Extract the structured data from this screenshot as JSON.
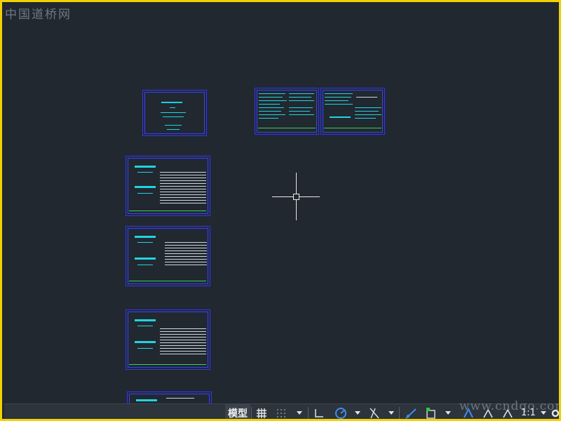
{
  "watermark_top": "中国道桥网",
  "watermark_bottom": "www.cndqo.com",
  "statusbar": {
    "model_label": "模型",
    "scale_label": "1:1",
    "icons": [
      "grid-icon",
      "snap-icon",
      "ortho-icon",
      "polar-icon",
      "isodraft-icon",
      "osnap-icon",
      "annotation-icon",
      "workspace-icon",
      "gear-icon"
    ]
  },
  "colors": {
    "background": "#212830",
    "frame": "#f2d200",
    "sheet_border": "#2f36ff",
    "cyan": "#23d3e0",
    "green": "#33d34a"
  }
}
